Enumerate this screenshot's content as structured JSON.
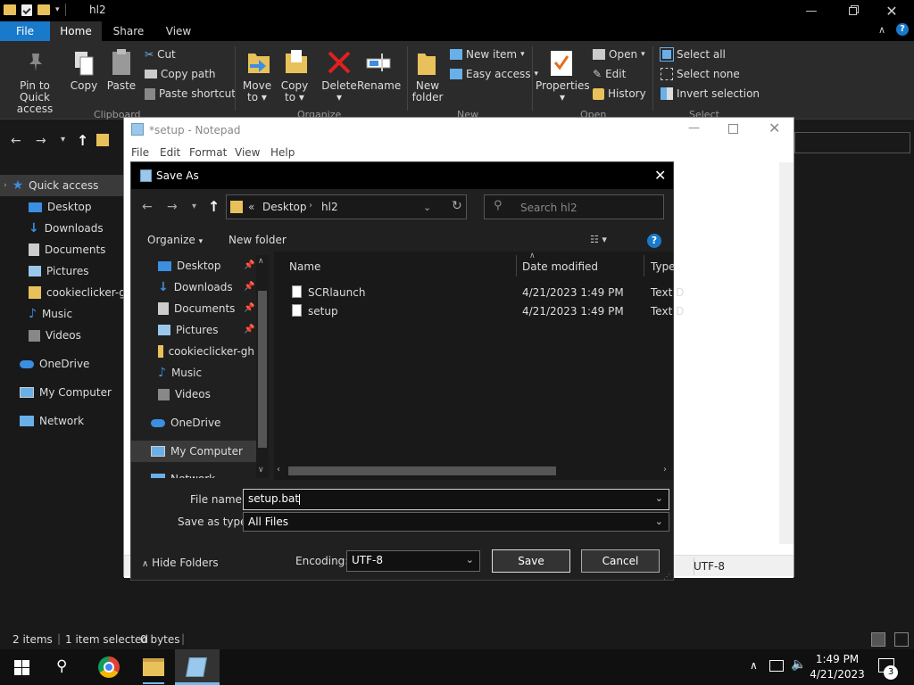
{
  "explorer": {
    "title": "hl2",
    "tabs": [
      "File",
      "Home",
      "Share",
      "View"
    ],
    "ribbon": {
      "pin_label": "Pin to Quick access",
      "copy_label": "Copy",
      "paste_label": "Paste",
      "cut_label": "Cut",
      "copy_path_label": "Copy path",
      "paste_shortcut_label": "Paste shortcut",
      "clipboard_group": "Clipboard",
      "move_to_label": "Move to",
      "copy_to_label": "Copy to",
      "delete_label": "Delete",
      "rename_label": "Rename",
      "organize_group": "Organize",
      "new_folder_label": "New folder",
      "new_item_label": "New item",
      "easy_access_label": "Easy access",
      "new_group": "New",
      "properties_label": "Properties",
      "open_label": "Open",
      "edit_label": "Edit",
      "history_label": "History",
      "open_group": "Open",
      "select_all_label": "Select all",
      "select_none_label": "Select none",
      "invert_selection_label": "Invert selection",
      "select_group": "Select"
    },
    "nav": {
      "quick_access": "Quick access",
      "desktop": "Desktop",
      "downloads": "Downloads",
      "documents": "Documents",
      "pictures": "Pictures",
      "cookieclicker": "cookieclicker-gh",
      "music": "Music",
      "videos": "Videos",
      "onedrive": "OneDrive",
      "my_computer": "My Computer",
      "network": "Network"
    },
    "status": {
      "items": "2 items",
      "selected": "1 item selected",
      "size": "0 bytes"
    }
  },
  "notepad": {
    "title": "*setup - Notepad",
    "menu": [
      "File",
      "Edit",
      "Format",
      "View",
      "Help"
    ],
    "encoding": "UTF-8"
  },
  "dialog": {
    "title": "Save As",
    "breadcrumb": {
      "prefix": "«",
      "part1": "Desktop",
      "part2": "hl2"
    },
    "search_placeholder": "Search hl2",
    "organize_label": "Organize",
    "new_folder_label": "New folder",
    "nav": {
      "desktop": "Desktop",
      "downloads": "Downloads",
      "documents": "Documents",
      "pictures": "Pictures",
      "cookieclicker": "cookieclicker-gh",
      "music": "Music",
      "videos": "Videos",
      "onedrive": "OneDrive",
      "my_computer": "My Computer",
      "network": "Network"
    },
    "columns": {
      "name": "Name",
      "date": "Date modified",
      "type": "Type"
    },
    "files": [
      {
        "name": "SCRlaunch",
        "date": "4/21/2023 1:49 PM",
        "type": "Text D"
      },
      {
        "name": "setup",
        "date": "4/21/2023 1:49 PM",
        "type": "Text D"
      }
    ],
    "file_name_label": "File name:",
    "file_name_value": "setup.bat",
    "save_type_label": "Save as type:",
    "save_type_value": "All Files",
    "hide_folders_label": "Hide Folders",
    "encoding_label": "Encoding:",
    "encoding_value": "UTF-8",
    "save_label": "Save",
    "cancel_label": "Cancel"
  },
  "taskbar": {
    "time": "1:49 PM",
    "date": "4/21/2023",
    "notification_count": "3"
  }
}
